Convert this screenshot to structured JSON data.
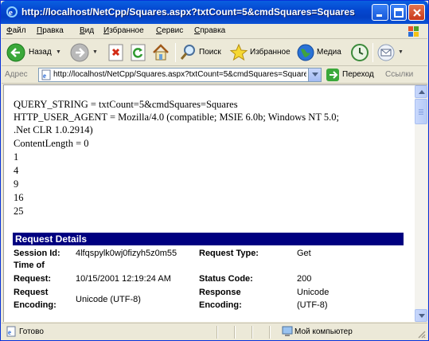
{
  "window": {
    "title": "http://localhost/NetCpp/Squares.aspx?txtCount=5&cmdSquares=Squares - Mi..."
  },
  "menu": [
    {
      "label": "Файл",
      "ul": "Ф",
      "rest": "айл"
    },
    {
      "label": "Правка",
      "ul": "П",
      "rest": "равка"
    },
    {
      "label": "Вид",
      "ul": "В",
      "rest": "ид"
    },
    {
      "label": "Избранное",
      "ul": "И",
      "rest": "збранное"
    },
    {
      "label": "Сервис",
      "ul": "С",
      "rest": "ервис"
    },
    {
      "label": "Справка",
      "ul": "С",
      "rest": "правка"
    }
  ],
  "toolbar": {
    "back": "Назад",
    "search": "Поиск",
    "favorites": "Избранное",
    "media": "Медиа"
  },
  "address": {
    "label": "Адрес",
    "url": "http://localhost/NetCpp/Squares.aspx?txtCount=5&cmdSquares=Squares",
    "go": "Переход",
    "links": "Ссылки"
  },
  "content": {
    "lines": [
      "QUERY_STRING = txtCount=5&cmdSquares=Squares",
      "HTTP_USER_AGENT = Mozilla/4.0 (compatible; MSIE 6.0b; Windows NT 5.0;",
      ".Net CLR 1.0.2914)",
      "ContentLength = 0",
      "1",
      "4",
      "9",
      "16",
      "25"
    ],
    "request_details": {
      "heading": "Request Details",
      "session_id_label": "Session Id:",
      "session_id_value": "4lfqspylk0wj0fizyh5z0m55",
      "request_type_label": "Request Type:",
      "request_type_value": "Get",
      "time_label_1": "Time of",
      "time_label_2": "Request:",
      "time_value": "10/15/2001 12:19:24 AM",
      "status_code_label": "Status Code:",
      "status_code_value": "200",
      "req_enc_label_1": "Request",
      "req_enc_label_2": "Encoding:",
      "req_enc_value": "Unicode (UTF-8)",
      "resp_enc_label_1": "Response",
      "resp_enc_label_2": "Encoding:",
      "resp_enc_value_1": "Unicode",
      "resp_enc_value_2": "(UTF-8)"
    }
  },
  "status": {
    "text": "Готово",
    "zone": "Мой компьютер"
  },
  "colors": {
    "titlebar": "#0447d0",
    "request_header": "#000080"
  }
}
